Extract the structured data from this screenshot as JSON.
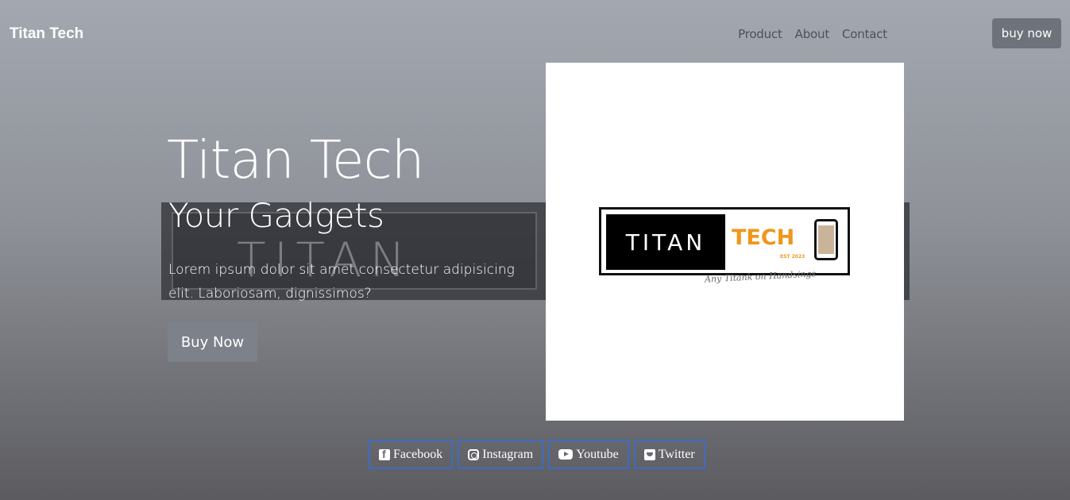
{
  "navbar": {
    "brand": "Titan Tech",
    "links": [
      "Product",
      "About",
      "Contact"
    ],
    "cta": "buy now"
  },
  "background_banner": {
    "word": "TITAN"
  },
  "hero": {
    "title": "Titan Tech",
    "subtitle": "Your Gadgets",
    "description": "Lorem ipsum dolor sit amet consectetur adipisicing elit. Laboriosam, dignissimos?",
    "cta": "Buy Now"
  },
  "logo": {
    "word_left": "TITAN",
    "word_right": "TECH",
    "est": "EST 2023",
    "tagline": "Any Titank on Handsings",
    "accent_color": "#f0961c",
    "icon": "smartphone-icon"
  },
  "social": [
    {
      "label": "Facebook",
      "icon": "facebook-icon"
    },
    {
      "label": "Instagram",
      "icon": "instagram-icon"
    },
    {
      "label": "Youtube",
      "icon": "youtube-icon"
    },
    {
      "label": "Twitter",
      "icon": "twitter-icon"
    }
  ],
  "colors": {
    "social_border": "#3d6cc4",
    "nav_button": "#6e737b"
  }
}
